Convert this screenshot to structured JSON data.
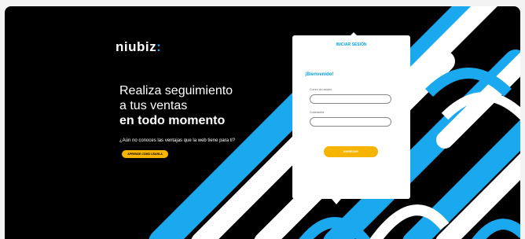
{
  "brand": {
    "name": "niubiz",
    "colon": ":"
  },
  "hero": {
    "line1": "Realiza seguimiento",
    "line2": "a tus ventas",
    "line3": "en todo momento",
    "tagline": "¿Aún no conoces las ventajas que la web tiene para ti?",
    "cta_label": "APRENDE CÓMO USARLA"
  },
  "login": {
    "title": "INICIAR SESIÓN",
    "welcome": "¡Bienvenido!",
    "user_label": "Correo de usuario",
    "user_value": "",
    "password_label": "Contraseña",
    "password_value": "",
    "submit_label": "INGRESAR"
  },
  "colors": {
    "accent_blue": "#1aa9ef",
    "accent_yellow": "#f4b400",
    "background": "#000000"
  }
}
